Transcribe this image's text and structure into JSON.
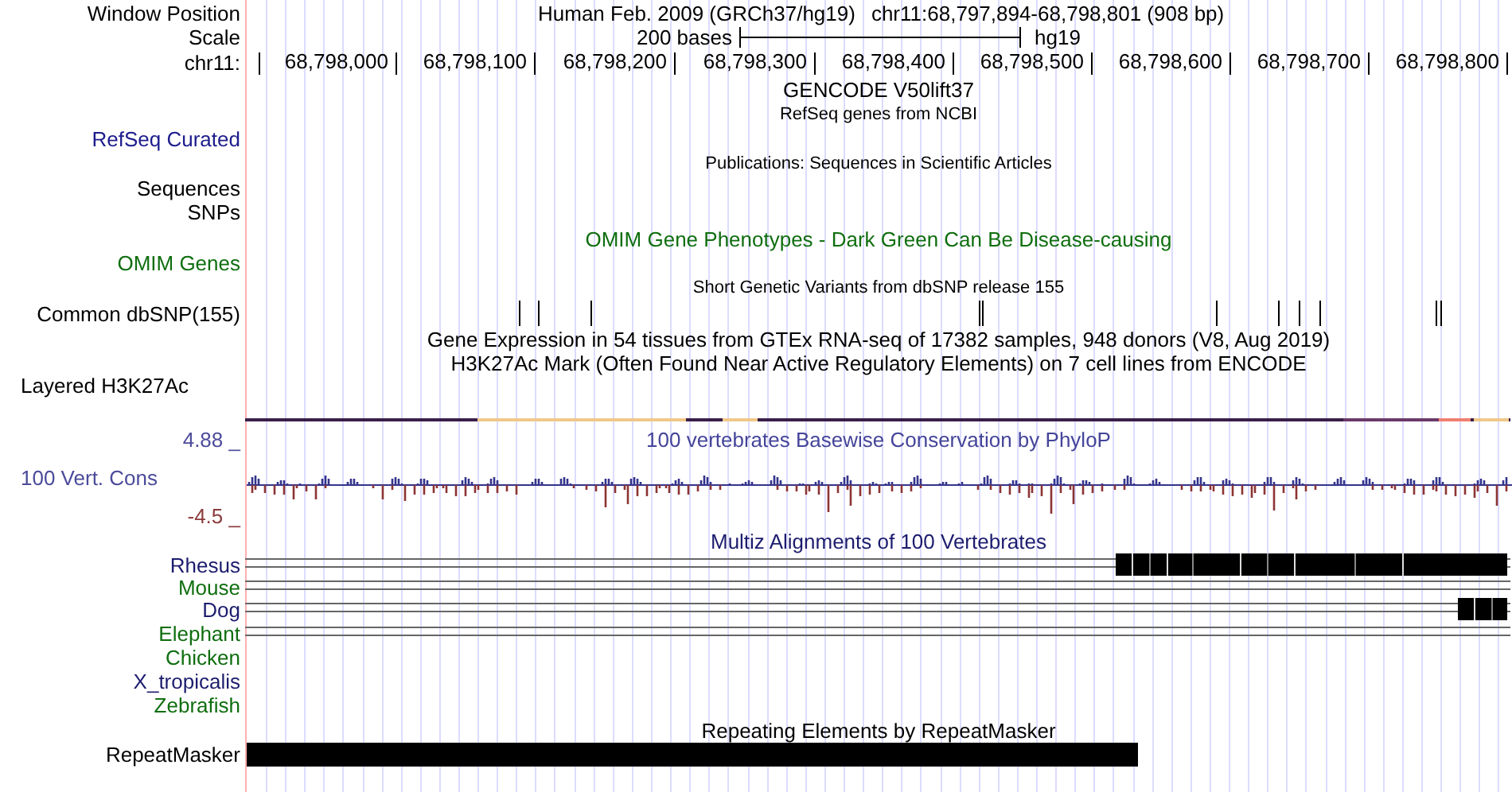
{
  "rows": [
    {
      "kind": "position",
      "label": "Window Position",
      "assembly": "Human Feb. 2009 (GRCh37/hg19)",
      "range": "chr11:68,797,894-68,798,801 (908 bp)"
    },
    {
      "kind": "scale",
      "label": "Scale",
      "length": "200 bases",
      "database": "hg19"
    },
    {
      "kind": "ruler",
      "label": "chr11:",
      "ticks": [
        "68,798,000",
        "68,798,100",
        "68,798,200",
        "68,798,300",
        "68,798,400",
        "68,798,500",
        "68,798,600",
        "68,798,700",
        "68,798,800"
      ]
    },
    {
      "kind": "title",
      "title": "GENCODE V50lift37",
      "color": "#000000"
    },
    {
      "kind": "subtitle",
      "title": "RefSeq genes from NCBI"
    },
    {
      "kind": "label",
      "label": "RefSeq Curated",
      "color": "#1c1c8c"
    },
    {
      "kind": "subtitle",
      "title": "Publications: Sequences in Scientific Articles"
    },
    {
      "kind": "label",
      "label": "Sequences",
      "color": "#000000"
    },
    {
      "kind": "label",
      "label": "SNPs",
      "color": "#000000"
    },
    {
      "kind": "title",
      "title": "OMIM Gene Phenotypes - Dark Green Can Be Disease-causing",
      "color": "#0f6e0f"
    },
    {
      "kind": "label",
      "label": "OMIM Genes",
      "color": "#0f6e0f"
    },
    {
      "kind": "subtitle",
      "title": "Short Genetic Variants from dbSNP release 155"
    },
    {
      "kind": "snps",
      "label": "Common dbSNP(155)"
    },
    {
      "kind": "title",
      "title": "Gene Expression in 54 tissues from GTEx RNA-seq of 17382 samples, 948 donors (V8, Aug 2019)",
      "color": "#000000"
    },
    {
      "kind": "title",
      "title": "H3K27Ac Mark (Often Found Near Active Regulatory Elements) on 7 cell lines from ENCODE",
      "color": "#000000"
    },
    {
      "kind": "layered",
      "label": "Layered H3K27Ac"
    },
    {
      "kind": "conservation",
      "max_label": "4.88 _",
      "label": "100 Vert. Cons",
      "min_label": "-4.5 _",
      "title": "100 vertebrates Basewise Conservation by PhyloP"
    },
    {
      "kind": "title",
      "title": "Multiz Alignments of 100 Vertebrates",
      "color": "#1c1c6e"
    },
    {
      "kind": "species",
      "label": "Rhesus",
      "color": "#1c1c6e",
      "aligned": true
    },
    {
      "kind": "species",
      "label": "Mouse",
      "color": "#0f6e0f",
      "aligned": true
    },
    {
      "kind": "species",
      "label": "Dog",
      "color": "#1c1c6e",
      "aligned": true
    },
    {
      "kind": "species",
      "label": "Elephant",
      "color": "#0f6e0f",
      "aligned": true
    },
    {
      "kind": "species",
      "label": "Chicken",
      "color": "#0f6e0f",
      "aligned": false
    },
    {
      "kind": "species",
      "label": "X_tropicalis",
      "color": "#1c1c6e",
      "aligned": false
    },
    {
      "kind": "species",
      "label": "Zebrafish",
      "color": "#0f6e0f",
      "aligned": false
    },
    {
      "kind": "title",
      "title": "Repeating Elements by RepeatMasker",
      "color": "#000000"
    },
    {
      "kind": "repeat",
      "label": "RepeatMasker"
    }
  ]
}
